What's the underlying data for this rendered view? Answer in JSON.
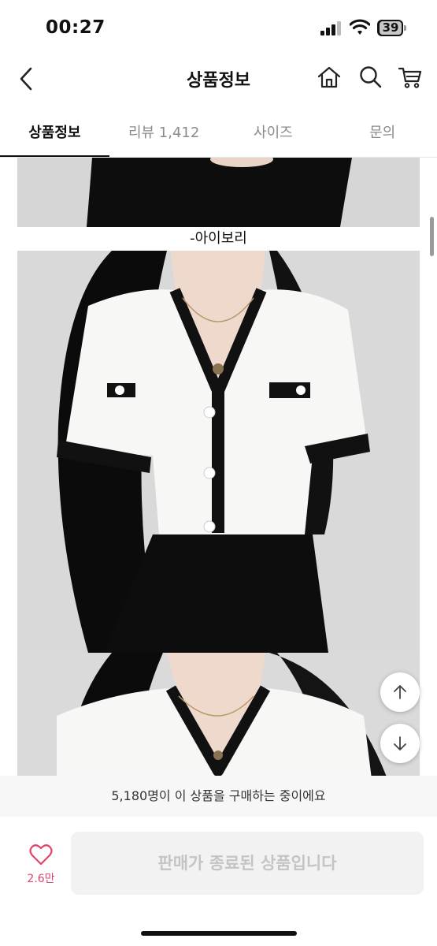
{
  "status_bar": {
    "time": "00:27",
    "battery": "39"
  },
  "header": {
    "title": "상품정보",
    "icons": [
      "back-icon",
      "home-icon",
      "search-icon",
      "cart-icon"
    ]
  },
  "tabs": [
    {
      "label": "상품정보",
      "active": true
    },
    {
      "label": "리뷰 1,412",
      "active": false
    },
    {
      "label": "사이즈",
      "active": false
    },
    {
      "label": "문의",
      "active": false
    }
  ],
  "content": {
    "color_caption": "-아이보리"
  },
  "scroll_buttons": [
    "arrow-up-icon",
    "arrow-down-icon"
  ],
  "purchase_notice": "5,180명이 이 상품을 구매하는 중이에요",
  "bottom": {
    "like_count": "2.6만",
    "buy_label": "판매가 종료된 상품입니다"
  },
  "colors": {
    "accent_pink": "#e0456a",
    "disabled_text": "#c4c4c4",
    "disabled_bg": "#f2f2f2"
  }
}
